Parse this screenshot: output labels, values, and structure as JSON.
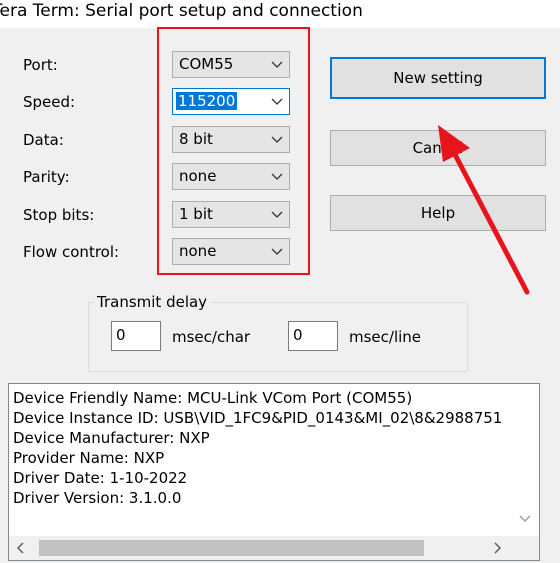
{
  "window": {
    "title": "Tera Term: Serial port setup and connection"
  },
  "fields": [
    {
      "label": "Port:",
      "value": "COM55"
    },
    {
      "label": "Speed:",
      "value": "115200"
    },
    {
      "label": "Data:",
      "value": "8 bit"
    },
    {
      "label": "Parity:",
      "value": "none"
    },
    {
      "label": "Stop bits:",
      "value": "1 bit"
    },
    {
      "label": "Flow control:",
      "value": "none"
    }
  ],
  "buttons": {
    "new_setting": "New setting",
    "cancel": "Cancel",
    "help": "Help"
  },
  "transmit_delay": {
    "title": "Transmit delay",
    "char_value": "0",
    "char_unit": "msec/char",
    "line_value": "0",
    "line_unit": "msec/line"
  },
  "device_info": [
    "Device Friendly Name: MCU-Link VCom Port (COM55)",
    "Device Instance ID: USB\\VID_1FC9&PID_0143&MI_02\\8&2988751",
    "Device Manufacturer: NXP",
    "Provider Name: NXP",
    "Driver Date: 1-10-2022",
    "Driver Version: 3.1.0.0"
  ],
  "colors": {
    "highlight": "#e8141d",
    "accent": "#0078d7"
  }
}
